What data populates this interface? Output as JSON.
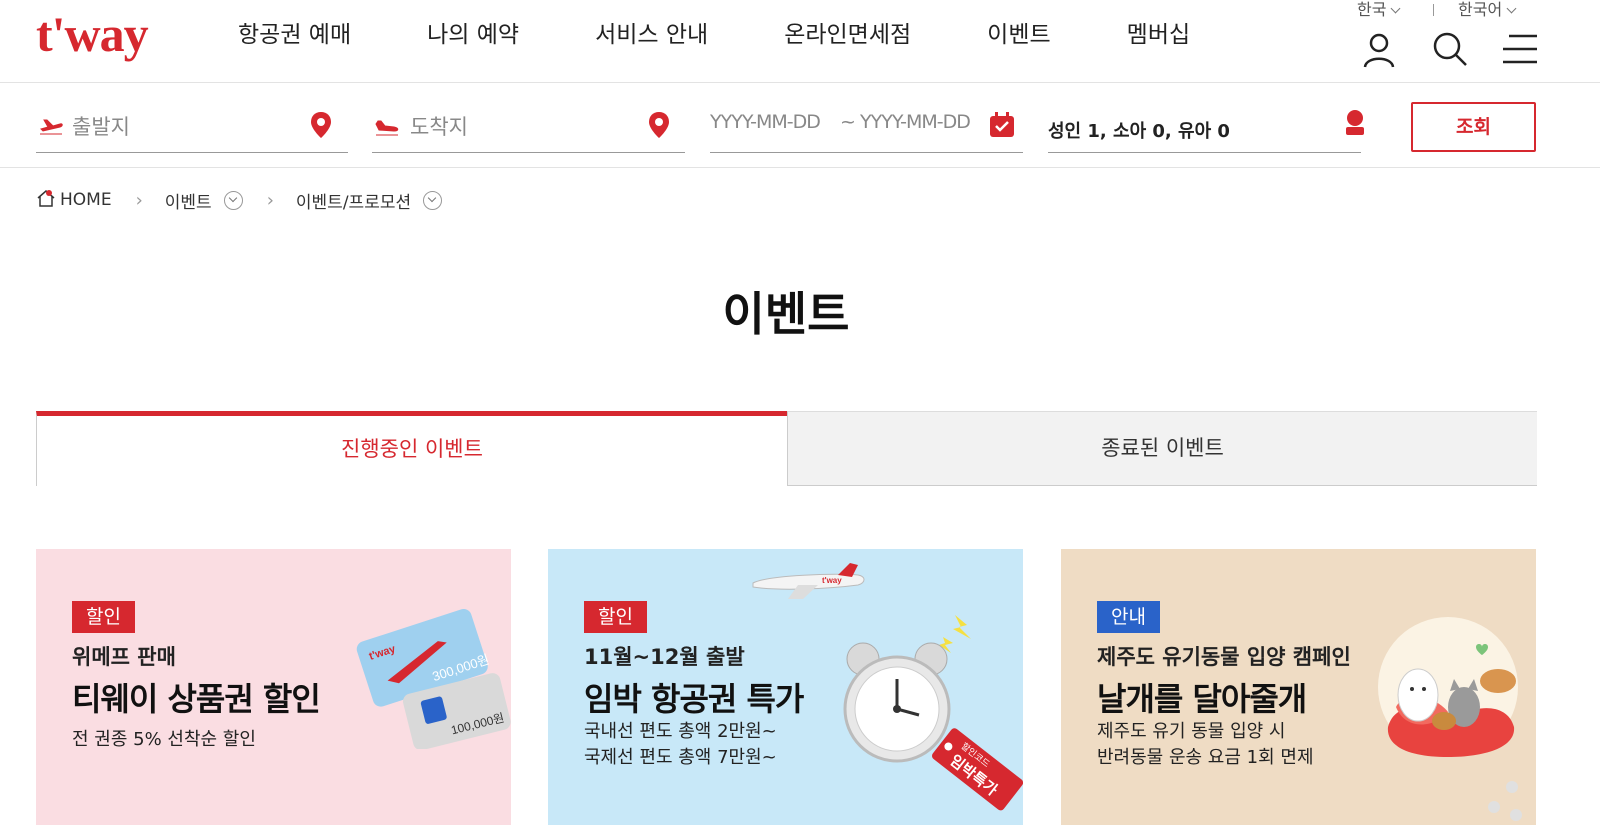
{
  "header": {
    "logo": "t'way",
    "nav": [
      "항공권 예매",
      "나의 예약",
      "서비스 안내",
      "온라인면세점",
      "이벤트",
      "멤버십"
    ],
    "country": "한국",
    "language": "한국어",
    "icons": [
      "user-icon",
      "search-icon",
      "menu-icon"
    ]
  },
  "search": {
    "departure_placeholder": "출발지",
    "arrival_placeholder": "도착지",
    "date_start_placeholder": "YYYY-MM-DD",
    "date_sep": "~",
    "date_end_placeholder": "YYYY-MM-DD",
    "passengers": "성인 1, 소아 0, 유아 0",
    "search_button": "조회"
  },
  "breadcrumb": {
    "home": "HOME",
    "level1": "이벤트",
    "level2": "이벤트/프로모션"
  },
  "page_title": "이벤트",
  "tabs": {
    "active": "진행중인 이벤트",
    "inactive": "종료된 이벤트"
  },
  "cards": [
    {
      "badge": "할인",
      "badge_color": "#d6282f",
      "subtitle": "위메프 판매",
      "title": "티웨이 상품권 할인",
      "desc1": "전 권종 5% 선착순 할인",
      "desc2": "",
      "bg": "#fadde2",
      "art": {
        "voucher1": "300,000원",
        "voucher2": "100,000원"
      }
    },
    {
      "badge": "할인",
      "badge_color": "#d6282f",
      "subtitle": "11월~12월 출발",
      "title": "임박 항공권 특가",
      "desc1": "국내선 편도 총액 2만원~",
      "desc2": "국제선 편도 총액 7만원~",
      "bg": "#c8e8f8",
      "art": {
        "tag": "임박특가",
        "tag_small": "할인코드",
        "plane": "t'way"
      }
    },
    {
      "badge": "안내",
      "badge_color": "#2a63c9",
      "subtitle": "제주도 유기동물 입양 캠페인",
      "title": "날개를 달아줄개",
      "desc1": "제주도 유기 동물 입양 시",
      "desc2": "반려동물 운송 요금 1회 면제",
      "bg": "#efdcc4"
    }
  ]
}
